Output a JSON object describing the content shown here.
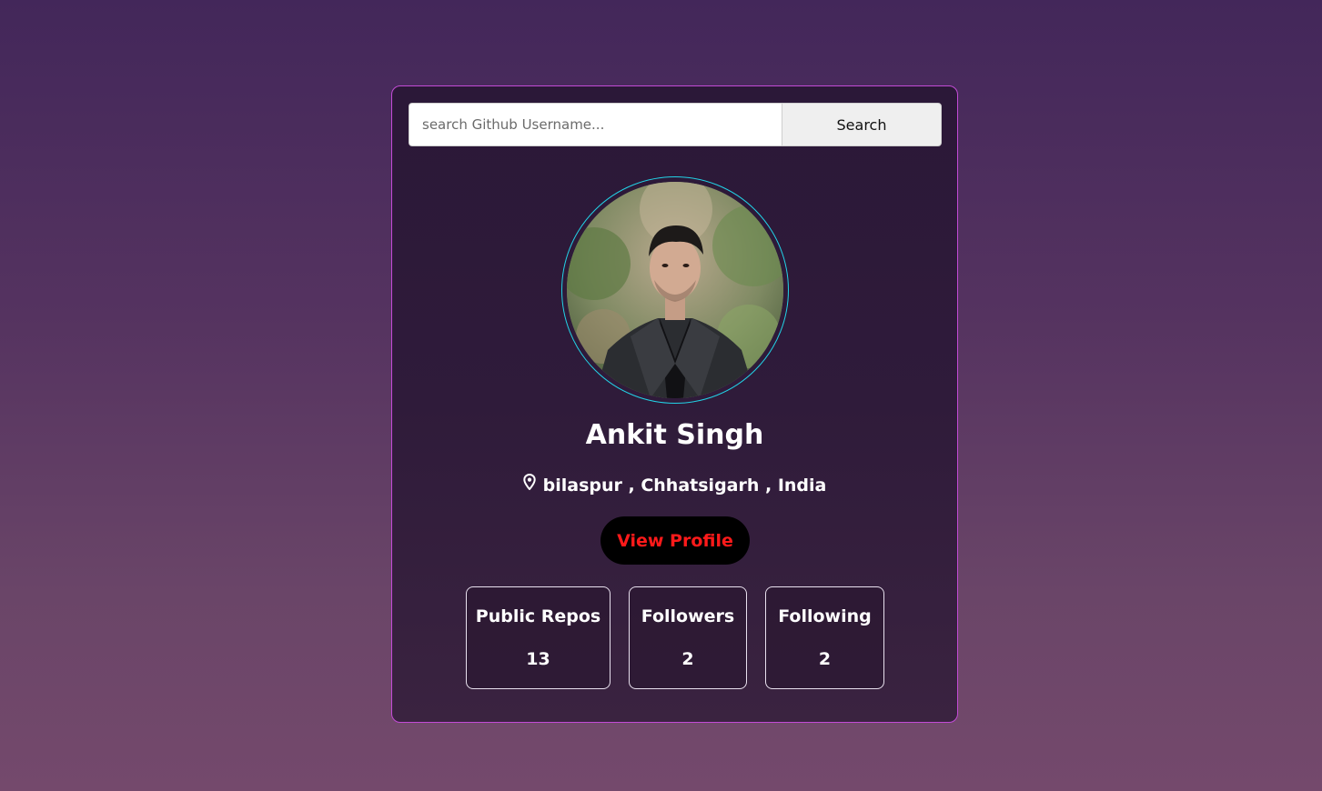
{
  "search": {
    "placeholder": "search Github Username...",
    "value": "",
    "button_label": "Search"
  },
  "profile": {
    "name": "Ankit Singh",
    "location": "bilaspur , Chhatsigarh , India",
    "view_profile_label": "View Profile"
  },
  "stats": [
    {
      "label": "Public Repos",
      "value": "13"
    },
    {
      "label": "Followers",
      "value": "2"
    },
    {
      "label": "Following",
      "value": "2"
    }
  ],
  "icons": {
    "location": "map-pin-icon"
  },
  "colors": {
    "card_border": "#c34bd6",
    "avatar_ring": "#22d3e6",
    "view_profile_text": "#ff1a1a",
    "view_profile_bg": "#000000"
  }
}
